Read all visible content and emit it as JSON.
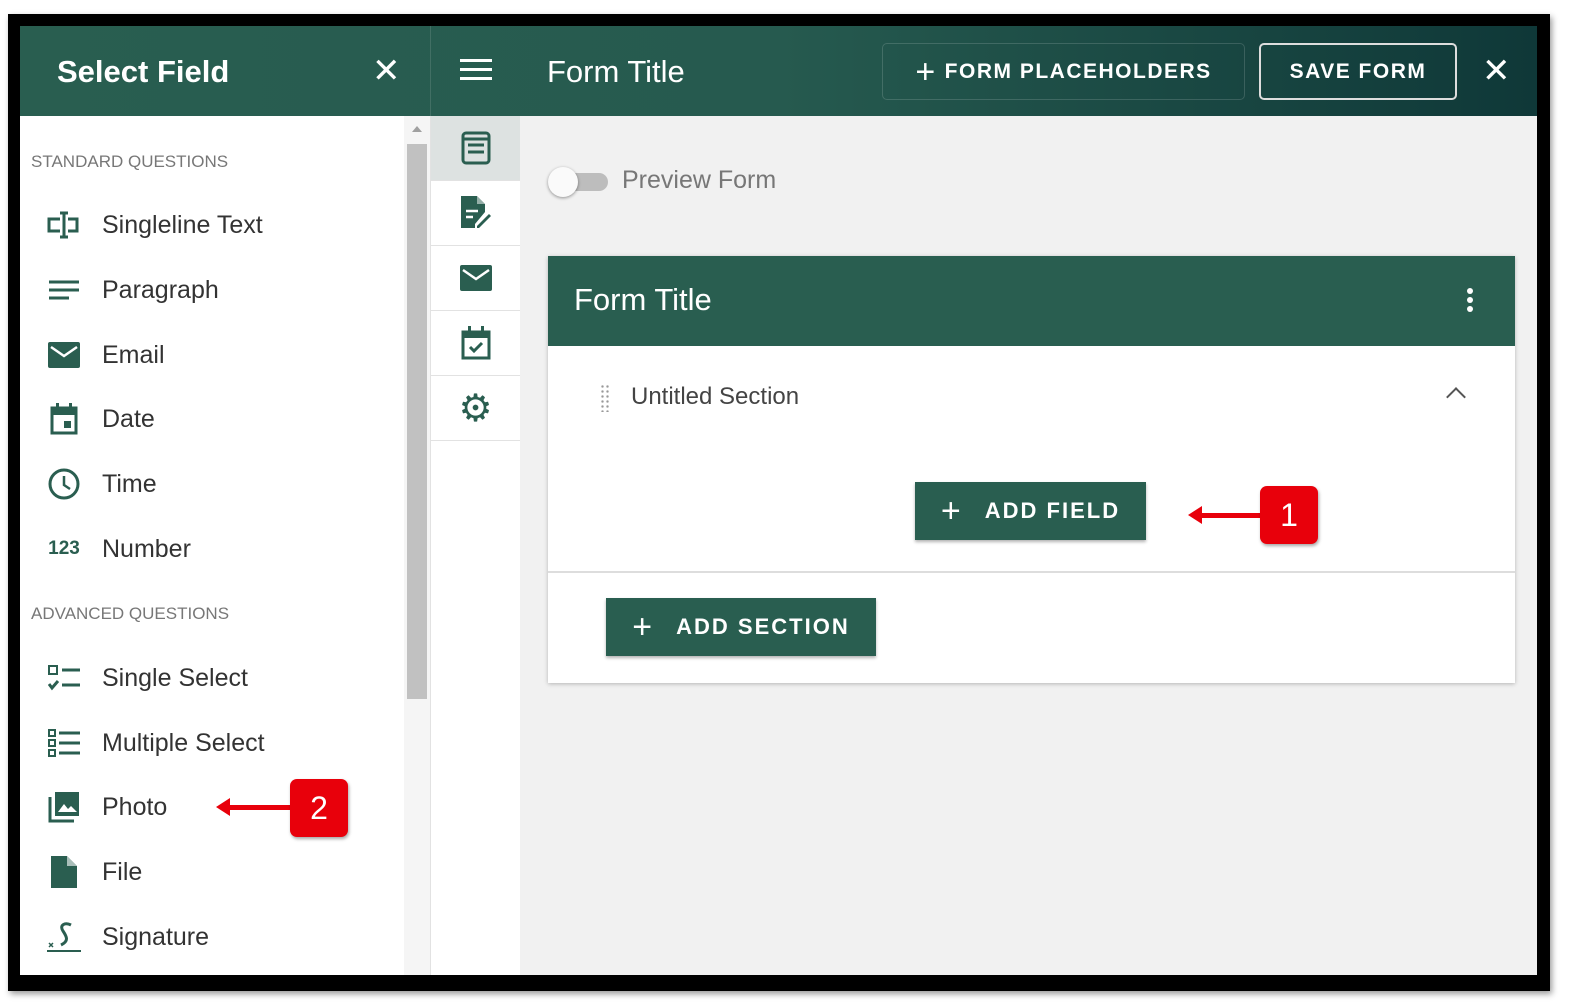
{
  "left_panel": {
    "title": "Select Field",
    "standard_heading": "STANDARD QUESTIONS",
    "standard": [
      {
        "label": "Singleline Text",
        "icon": "text-field-icon"
      },
      {
        "label": "Paragraph",
        "icon": "paragraph-icon"
      },
      {
        "label": "Email",
        "icon": "email-icon"
      },
      {
        "label": "Date",
        "icon": "calendar-icon"
      },
      {
        "label": "Time",
        "icon": "clock-icon"
      },
      {
        "label": "Number",
        "icon": "number-icon",
        "glyph": "123"
      }
    ],
    "advanced_heading": "ADVANCED QUESTIONS",
    "advanced": [
      {
        "label": "Single Select",
        "icon": "single-select-icon"
      },
      {
        "label": "Multiple Select",
        "icon": "multiple-select-icon"
      },
      {
        "label": "Photo",
        "icon": "photo-icon"
      },
      {
        "label": "File",
        "icon": "file-icon"
      },
      {
        "label": "Signature",
        "icon": "signature-icon"
      }
    ]
  },
  "header": {
    "title": "Form Title",
    "placeholders_label": "FORM PLACEHOLDERS",
    "save_label": "SAVE FORM"
  },
  "main": {
    "preview_label": "Preview Form",
    "preview_on": false,
    "form_title": "Form Title",
    "section_title": "Untitled Section",
    "add_field_label": "ADD FIELD",
    "add_section_label": "ADD SECTION"
  },
  "annotations": [
    "1",
    "2"
  ],
  "colors": {
    "primary": "#295e50",
    "callout": "#e8000b"
  }
}
